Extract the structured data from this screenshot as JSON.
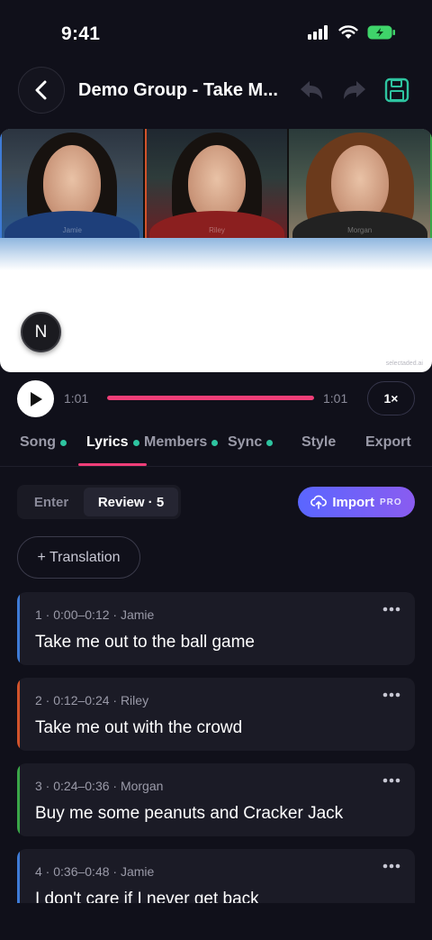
{
  "status_bar": {
    "time": "9:41"
  },
  "nav": {
    "title": "Demo Group - Take M..."
  },
  "preview": {
    "members": [
      "Jamie",
      "Riley",
      "Morgan"
    ],
    "badge": "N",
    "watermark": "selectaded.ai"
  },
  "player": {
    "current": "1:01",
    "total": "1:01",
    "speed": "1×",
    "progress": 1.0
  },
  "tabs": [
    {
      "label": "Song",
      "done": true
    },
    {
      "label": "Lyrics",
      "done": true,
      "active": true
    },
    {
      "label": "Members",
      "done": true
    },
    {
      "label": "Sync",
      "done": true
    },
    {
      "label": "Style",
      "done": false
    },
    {
      "label": "Export",
      "done": false
    }
  ],
  "segmented": {
    "enter": "Enter",
    "review": "Review · 5"
  },
  "import": {
    "label": "Import",
    "badge": "PRO"
  },
  "translation": {
    "label": "+ Translation"
  },
  "lyrics": [
    {
      "meta": "1 · 0:00–0:12 · Jamie",
      "text": "Take me out to the ball game",
      "color": "#3e7bd6"
    },
    {
      "meta": "2 · 0:12–0:24 · Riley",
      "text": "Take me out with the crowd",
      "color": "#d2532b"
    },
    {
      "meta": "3 · 0:24–0:36 · Morgan",
      "text": "Buy me some peanuts and Cracker Jack",
      "color": "#3aa648"
    },
    {
      "meta": "4 · 0:36–0:48 · Jamie",
      "text": "I don't care if I never get back",
      "color": "#3e7bd6"
    }
  ],
  "colors": {
    "accent_pink": "#f03e78",
    "accent_teal": "#2ec4a0",
    "import_gradient": [
      "#5a66ff",
      "#8a5cf0"
    ]
  }
}
